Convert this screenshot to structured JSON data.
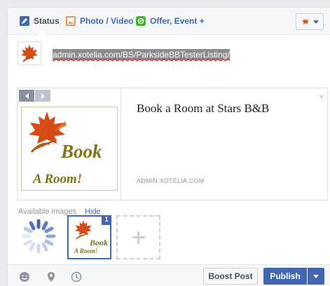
{
  "tabs": {
    "status_label": "Status",
    "photo_label": "Photo / Video",
    "offer_label": "Offer, Event +"
  },
  "post": {
    "text": "admin.xotelia.com/BS/ParksideBBTesterListing/"
  },
  "link_preview": {
    "title": "Book a Room at Stars B&B",
    "domain": "ADMIN.XOTELIA.COM",
    "logo_word1": "Book",
    "logo_word2": "A Room",
    "logo_bang": "!"
  },
  "images": {
    "label": "Available images",
    "hide_label": "Hide",
    "selected_count": "1"
  },
  "footer": {
    "boost_label": "Boost Post",
    "publish_label": "Publish"
  },
  "colors": {
    "accent": "#4267b2",
    "leaf": "#d64b16",
    "logo_text": "#7f7419"
  }
}
